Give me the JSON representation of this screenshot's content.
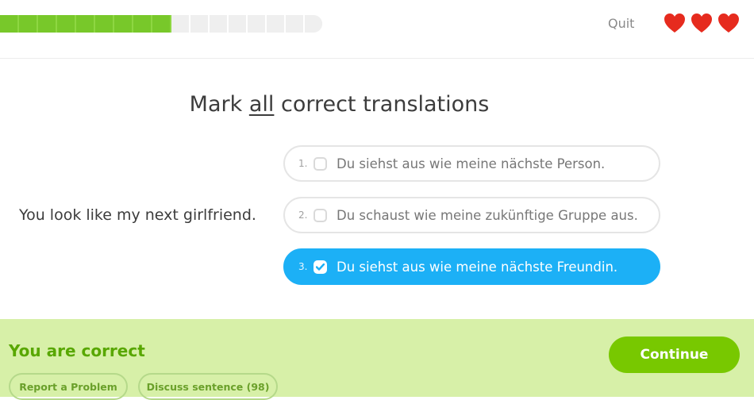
{
  "header": {
    "progress": {
      "completed_segments": 9,
      "total_segments": 17
    },
    "quit_label": "Quit",
    "hearts": {
      "count": 3,
      "color": "#e62b1e"
    }
  },
  "exercise": {
    "title_before": "Mark ",
    "title_emphasis": "all",
    "title_after": " correct translations",
    "prompt": "You look like my next girlfriend.",
    "options": [
      {
        "number": "1.",
        "text": "Du siehst aus wie meine nächste Person.",
        "checked": false
      },
      {
        "number": "2.",
        "text": "Du schaust wie meine zukünftige Gruppe aus.",
        "checked": false
      },
      {
        "number": "3.",
        "text": "Du siehst aus wie meine nächste Freundin.",
        "checked": true
      }
    ]
  },
  "footer": {
    "result_text": "You are correct",
    "continue_label": "Continue",
    "report_label": "Report a Problem",
    "discuss_label": "Discuss sentence (98)"
  },
  "colors": {
    "progress_fill": "#78c82a",
    "selected_option": "#1cb0f6",
    "footer_background": "#d7f0a8",
    "continue_button": "#78c800",
    "result_text": "#58a700"
  }
}
